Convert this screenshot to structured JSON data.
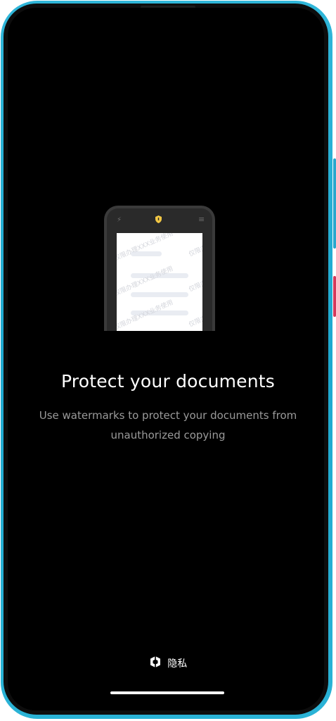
{
  "colors": {
    "frame": "#2fb6d9",
    "screen_bg": "#000000",
    "headline": "#ffffff",
    "subline": "#9a9a9a",
    "shield": "#f2c744",
    "power_button": "#d43a5c"
  },
  "illustration": {
    "status_icons": [
      "flash-icon",
      "shield-icon",
      "menu-icon"
    ],
    "watermark_text": "仅限办理XXX业务使用"
  },
  "onboarding": {
    "title": "Protect your documents",
    "description": "Use watermarks to protect your documents from unauthorized copying"
  },
  "footer": {
    "brand_icon": "privacy-shield-icon",
    "brand_label": "隐私"
  }
}
